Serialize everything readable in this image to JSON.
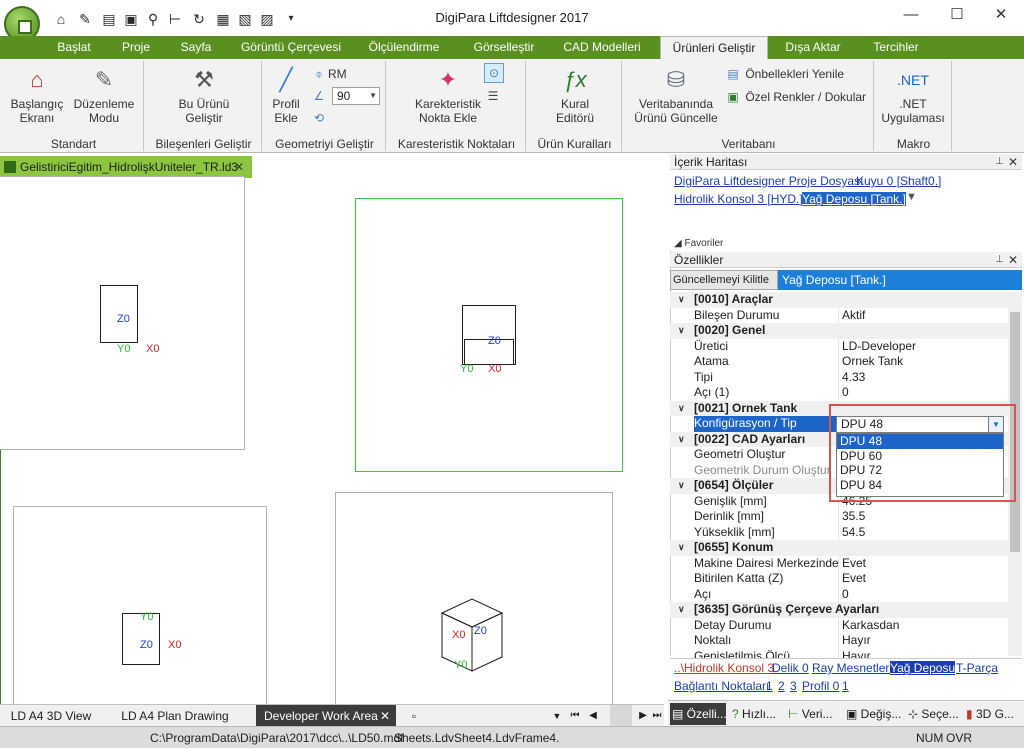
{
  "window": {
    "title": "DigiPara Liftdesigner 2017",
    "minimize": "—",
    "maximize": "☐",
    "close": "✕"
  },
  "quick_access": [
    "home",
    "pen",
    "open",
    "save",
    "search",
    "tree",
    "refresh",
    "sheet",
    "sheet-edit",
    "sheet-check"
  ],
  "menus": [
    {
      "label": "Başlat"
    },
    {
      "label": "Proje"
    },
    {
      "label": "Sayfa"
    },
    {
      "label": "Görüntü Çerçevesi"
    },
    {
      "label": "Ölçülendirme"
    },
    {
      "label": "Görselleştir"
    },
    {
      "label": "CAD Modelleri"
    },
    {
      "label": "Ürünleri Geliştir"
    },
    {
      "label": "Dışa Aktar"
    },
    {
      "label": "Tercihler"
    }
  ],
  "ribbon": {
    "standart": {
      "label": "Standart",
      "btn1": "Başlangıç Ekranı",
      "btn2": "Düzenleme Modu"
    },
    "bilesenler": {
      "label": "Bileşenleri Geliştir",
      "btn1": "Bu Ürünü Geliştir"
    },
    "geometri": {
      "label": "Geometriyi Geliştir",
      "btn1": "Profil Ekle",
      "rm": "RM",
      "combo": "90"
    },
    "karakteristik": {
      "label": "Karesteristik Noktaları",
      "btn1": "Karekteristik Nokta Ekle"
    },
    "kurallar": {
      "label": "Ürün Kuralları",
      "btn1": "Kural Editörü"
    },
    "veritabani": {
      "label": "Veritabanı",
      "btn1": "Veritabanında Ürünü Güncelle",
      "btn2": "Önbellekleri Yenile",
      "btn3": "Özel Renkler / Dokular"
    },
    "makro": {
      "label": "Makro",
      "btn1": ".NET Uygulaması"
    }
  },
  "document_tab": {
    "label": "GelistiriciEgitim_HidrolişkUniteler_TR.ld3",
    "close": "✕"
  },
  "axes": {
    "z0": "Z0",
    "y0": "Y0",
    "x0": "X0"
  },
  "bottom_tabs": [
    {
      "label": "LD A4 3D View"
    },
    {
      "label": "LD A4 Plan Drawing"
    },
    {
      "label": "Developer Work Area",
      "close": "✕"
    }
  ],
  "status": {
    "path": "C:\\ProgramData\\DigiPara\\2017\\dcc\\..\\LD50.mdf",
    "sheet": "Sheets.LdvSheet4.LdvFrame4.",
    "num": "NUM",
    "ovr": "OVR"
  },
  "content_map": {
    "title": "İçerik Haritası",
    "links": [
      "DigiPara Liftdesigner Proje Dosyası",
      "Kuyu 0 [Shaft0.]",
      "Hidrolik Konsol 3 [HYD.]",
      "Yağ Deposu [Tank.]"
    ],
    "overflow": "◢ Favoriler"
  },
  "properties": {
    "title": "Özellikler",
    "lock_button": "Güncellemeyi Kilitle",
    "selected": "Yağ Deposu [Tank.]",
    "rows": [
      {
        "type": "cat",
        "k": "[0010] Araçlar"
      },
      {
        "type": "row",
        "k": "Bileşen Durumu",
        "v": "Aktif"
      },
      {
        "type": "cat",
        "k": "[0020] Genel"
      },
      {
        "type": "row",
        "k": "Üretici",
        "v": "LD-Developer"
      },
      {
        "type": "row",
        "k": "Atama",
        "v": "Ornek Tank"
      },
      {
        "type": "row",
        "k": "Tipi",
        "v": "4.33"
      },
      {
        "type": "row",
        "k": "Açı (1)",
        "v": "0"
      },
      {
        "type": "cat",
        "k": "[0021] Ornek Tank"
      },
      {
        "type": "sel",
        "k": "Konfigürasyon / Tip",
        "v": ""
      },
      {
        "type": "cat",
        "k": "[0022] CAD Ayarları"
      },
      {
        "type": "row",
        "k": "Geometri Oluştur",
        "v": ""
      },
      {
        "type": "dis",
        "k": "Geometrik Durum Oluştur",
        "v": ""
      },
      {
        "type": "cat",
        "k": "[0654] Ölçüler"
      },
      {
        "type": "row",
        "k": "Genişlik [mm]",
        "v": "46.25"
      },
      {
        "type": "row",
        "k": "Derinlik [mm]",
        "v": "35.5"
      },
      {
        "type": "row",
        "k": "Yükseklik [mm]",
        "v": "54.5"
      },
      {
        "type": "cat",
        "k": "[0655] Konum"
      },
      {
        "type": "row",
        "k": "Makine Dairesi Merkezinde (X",
        "v": "Evet"
      },
      {
        "type": "row",
        "k": "Bitirilen Katta (Z)",
        "v": "Evet"
      },
      {
        "type": "row",
        "k": "Açı",
        "v": "0"
      },
      {
        "type": "cat",
        "k": "[3635] Görünüş Çerçeve Ayarları"
      },
      {
        "type": "row",
        "k": "Detay Durumu",
        "v": "Karkasdan"
      },
      {
        "type": "row",
        "k": "Noktalı",
        "v": "Hayır"
      },
      {
        "type": "row",
        "k": "Genişletilmiş Ölçü",
        "v": "Hayır"
      }
    ],
    "combo_value": "DPU 48",
    "options": [
      "DPU 48",
      "DPU 60",
      "DPU 72",
      "DPU 84"
    ],
    "selected_option": "DPU 48"
  },
  "breadcrumbs": {
    "line1": [
      "..\\Hidrolik Konsol 3",
      "Delik 0",
      "Ray Mesnetleri",
      "Yağ Deposu",
      "T-Parça"
    ],
    "line2": [
      "Bağlantı Noktaları",
      "1",
      "2",
      "3",
      "Profil 0",
      "1"
    ]
  },
  "panel_tabs": [
    {
      "label": "Özelli..."
    },
    {
      "label": "Hızlı..."
    },
    {
      "label": "Veri..."
    },
    {
      "label": "Değiş..."
    },
    {
      "label": "Seçe..."
    },
    {
      "label": "3D G..."
    }
  ]
}
